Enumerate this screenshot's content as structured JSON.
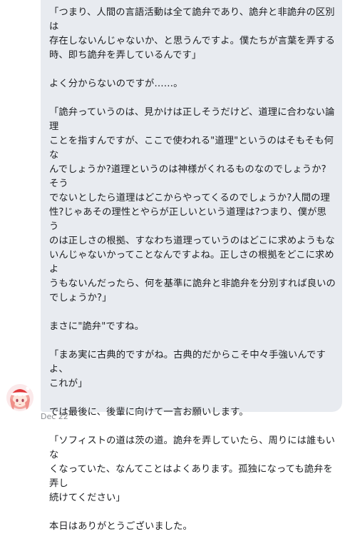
{
  "message": {
    "paragraphs": [
      "「つまり、人間の言語活動は全て詭弁であり、詭弁と非詭弁の区別は\n存在しないんじゃないか、と思うんですよ。僕たちが言葉を弄する\n時、即ち詭弁を弄しているんです」",
      "よく分からないのですが……。",
      "「詭弁っていうのは、見かけは正しそうだけど、道理に合わない論理\nことを指すんですが、ここで使われる\"道理\"というのはそもそも何な\nんでしょうか?道理というのは神様がくれるものなのでしょうか?そう\nでないとしたら道理はどこからやってくるのでしょうか?人間の理\n性?じゃあその理性とやらが正しいという道理は?つまり、僕が思う\nのは正しさの根拠、すなわち道理っていうのはどこに求めようもな\nいんじゃないかってことなんですよね。正しさの根拠をどこに求めよ\nうもないんだったら、何を基準に詭弁と非詭弁を分別すれば良いの\nでしょうか?」",
      "まさに\"詭弁\"ですね。",
      "「まあ実に古典的ですがね。古典的だからこそ中々手強いんですよ、\nこれが」",
      "では最後に、後輩に向けて一言お願いします。",
      "「ソフィストの道は茨の道。詭弁を弄していたら、周りには誰もいな\nくなっていた、なんてことはよくあります。孤独になっても詭弁を弄し\n続けてください」",
      "本日はありがとうございました。"
    ],
    "timestamp": "Dec 22"
  },
  "sender": {
    "avatar_icon": "anime-girl-avatar-icon"
  }
}
